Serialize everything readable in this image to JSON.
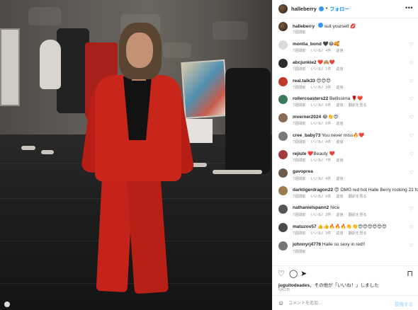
{
  "photo": {
    "alt_subject": ""
  },
  "header": {
    "username": "halleberry",
    "separator": "•",
    "follow_label": "フォロー",
    "more_label": "•••"
  },
  "caption": {
    "username": "halleberry",
    "text": "suit yourself 💋",
    "time": "7週間前"
  },
  "comments": [
    {
      "username": "montia_bond",
      "text": "🖤😂🥰",
      "time": "7週間前",
      "likes": "いいね！4件",
      "reply": "返信",
      "translate": "",
      "avatar_color": "#dbdbdb"
    },
    {
      "username": "abcjunkie2",
      "text": "❤️🙈❤️",
      "time": "7週間前",
      "likes": "いいね！1件",
      "reply": "返信",
      "translate": "",
      "avatar_color": "#2d2d2d"
    },
    {
      "username": "real.talk33",
      "text": "😍😍😍",
      "time": "7週間前",
      "likes": "いいね！3件",
      "reply": "返信",
      "translate": "",
      "avatar_color": "#c0392b"
    },
    {
      "username": "rollercoasters22",
      "text": "Bellissima 🌹❤️",
      "time": "7週間前",
      "likes": "いいね！5件",
      "reply": "返信",
      "translate": "翻訳を見る",
      "avatar_color": "#3c7a5a"
    },
    {
      "username": "mverner2024",
      "text": "😂👏😍",
      "time": "7週間前",
      "likes": "いいね！6件",
      "reply": "返信",
      "translate": "",
      "avatar_color": "#8a6b57"
    },
    {
      "username": "cree_baby73",
      "text": "You never miss🔥❤️",
      "time": "7週間前",
      "likes": "いいね！4件",
      "reply": "返信",
      "translate": "",
      "avatar_color": "#7a7a7a"
    },
    {
      "username": "rejiute",
      "text": "❤️Beauty ❤️",
      "time": "7週間前",
      "likes": "いいね！7件",
      "reply": "返信",
      "translate": "",
      "avatar_color": "#a23b3b"
    },
    {
      "username": "gavoprea",
      "text": "",
      "time": "7週間前",
      "likes": "いいね！4件",
      "reply": "返信",
      "translate": "",
      "avatar_color": "#6d5c4e"
    },
    {
      "username": "darktigerdragon22",
      "text": "😍 OMG red hot Halle Berry rocking 21 forever😍",
      "time": "7週間前",
      "likes": "いいね！9件",
      "reply": "返信",
      "translate": "翻訳を見る",
      "avatar_color": "#9a7b4f"
    },
    {
      "username": "nathanielspann2",
      "text": "Nice",
      "time": "7週間前",
      "likes": "いいね！3件",
      "reply": "返信",
      "translate": "翻訳を見る",
      "avatar_color": "#555555"
    },
    {
      "username": "matuzov57",
      "text": "👍👍🔥🔥🔥👏👏😍😍😍😍😍😍",
      "time": "7週間前",
      "likes": "いいね！3件",
      "reply": "返信",
      "translate": "翻訳を見る",
      "avatar_color": "#4a4a4a"
    },
    {
      "username": "johnnyrj4776",
      "text": "Halle so sexy in red!!",
      "time": "7週間前",
      "likes": "",
      "reply": "",
      "translate": "",
      "avatar_color": "#777777"
    }
  ],
  "actions": {
    "likes_user": "juguitodeades",
    "likes_suffix": "、その他が「いいね！」しました",
    "date": "6月2日",
    "comment_placeholder": "コメントを追加...",
    "post_label": "投稿する"
  }
}
